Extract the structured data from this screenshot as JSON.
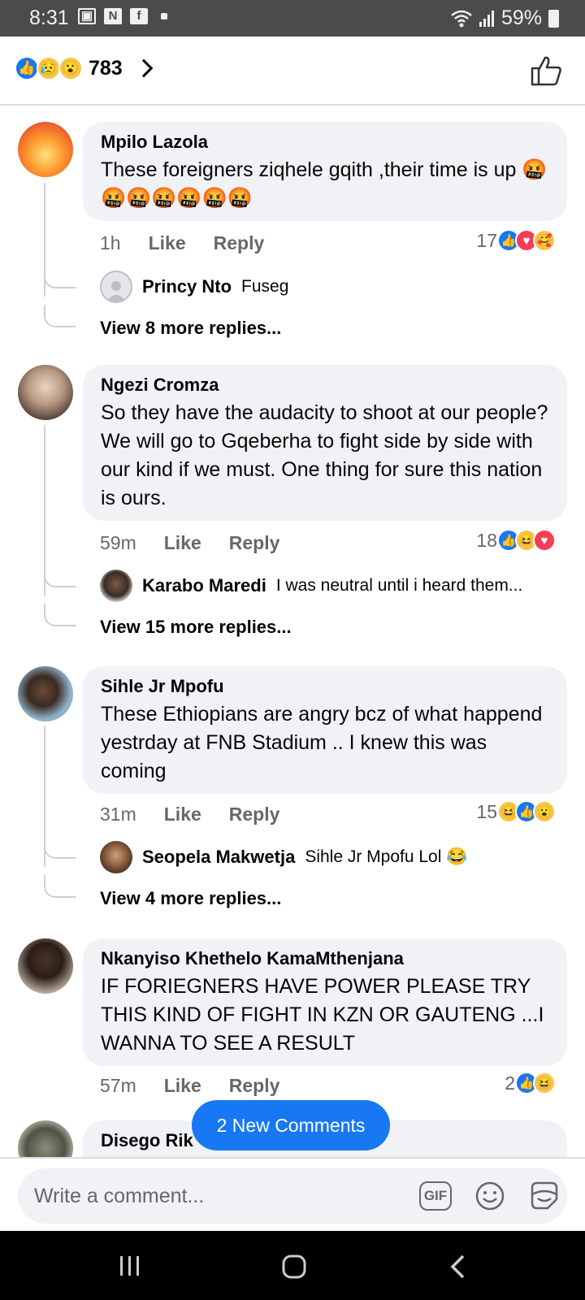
{
  "status": {
    "time": "8:31",
    "battery": "59%"
  },
  "header": {
    "reaction_count": "783"
  },
  "comments": [
    {
      "name": "Mpilo Lazola",
      "text": "These foreigners ziqhele gqith ,their time is up",
      "emoji_row": "🤬🤬🤬🤬🤬🤬🤬",
      "time": "1h",
      "like": "Like",
      "reply": "Reply",
      "reactions": "17",
      "reply_preview": {
        "name": "Princy Nto",
        "text": "Fuseg"
      },
      "view_more": "View 8 more replies..."
    },
    {
      "name": "Ngezi Cromza",
      "text": "So they have the audacity to shoot at our people? We will go to Gqeberha to fight side by side with our kind if we must. One thing for sure this nation is ours.",
      "time": "59m",
      "like": "Like",
      "reply": "Reply",
      "reactions": "18",
      "reply_preview": {
        "name": "Karabo Maredi",
        "text": "I was neutral until i heard them..."
      },
      "view_more": "View 15 more replies..."
    },
    {
      "name": "Sihle Jr Mpofu",
      "text": "These Ethiopians are angry bcz of what happend yestrday at FNB Stadium ..  I knew this was coming",
      "time": "31m",
      "like": "Like",
      "reply": "Reply",
      "reactions": "15",
      "reply_preview": {
        "name": "Seopela Makwetja",
        "text": "Sihle Jr Mpofu Lol 😂"
      },
      "view_more": "View 4 more replies..."
    },
    {
      "name": "Nkanyiso Khethelo KamaMthenjana",
      "text": "IF FORIEGNERS HAVE POWER PLEASE TRY THIS KIND OF FIGHT IN KZN OR GAUTENG ...I WANNA TO SEE A RESULT",
      "time": "57m",
      "like": "Like",
      "reply": "Reply",
      "reactions": "2"
    },
    {
      "name": "Disego Rik"
    }
  ],
  "new_comments": "2 New Comments",
  "composer": {
    "placeholder": "Write a comment..."
  },
  "icons": {
    "gif": "GIF"
  }
}
